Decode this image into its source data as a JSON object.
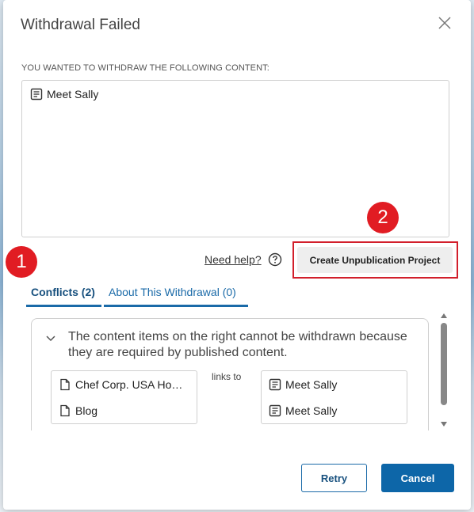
{
  "dialog": {
    "title": "Withdrawal Failed",
    "subtitle": "YOU WANTED TO WITHDRAW THE FOLLOWING CONTENT:",
    "content_items": [
      "Meet Sally"
    ],
    "help_link": "Need help?",
    "primary_action": "Create Unpublication Project",
    "tabs": [
      {
        "label": "Conflicts (2)",
        "active": true
      },
      {
        "label": "About This Withdrawal (0)",
        "active": false
      }
    ],
    "conflict_message": "The content items on the right cannot be withdrawn because they are required by published content.",
    "links_to": "links to",
    "left_items": [
      "Chef Corp. USA Ho…",
      "Blog"
    ],
    "right_items": [
      "Meet Sally",
      "Meet Sally"
    ],
    "buttons": {
      "retry": "Retry",
      "cancel": "Cancel"
    }
  },
  "annotations": [
    "1",
    "2"
  ],
  "colors": {
    "accent": "#1a6aa8",
    "cancel_bg": "#0d66a8",
    "annotation_red": "#e11c23",
    "highlight_border": "#d21f2b"
  },
  "icons": {
    "close": "close-icon",
    "article": "article-icon",
    "page": "page-icon",
    "help": "help-icon",
    "chevron": "chevron-down-icon"
  }
}
